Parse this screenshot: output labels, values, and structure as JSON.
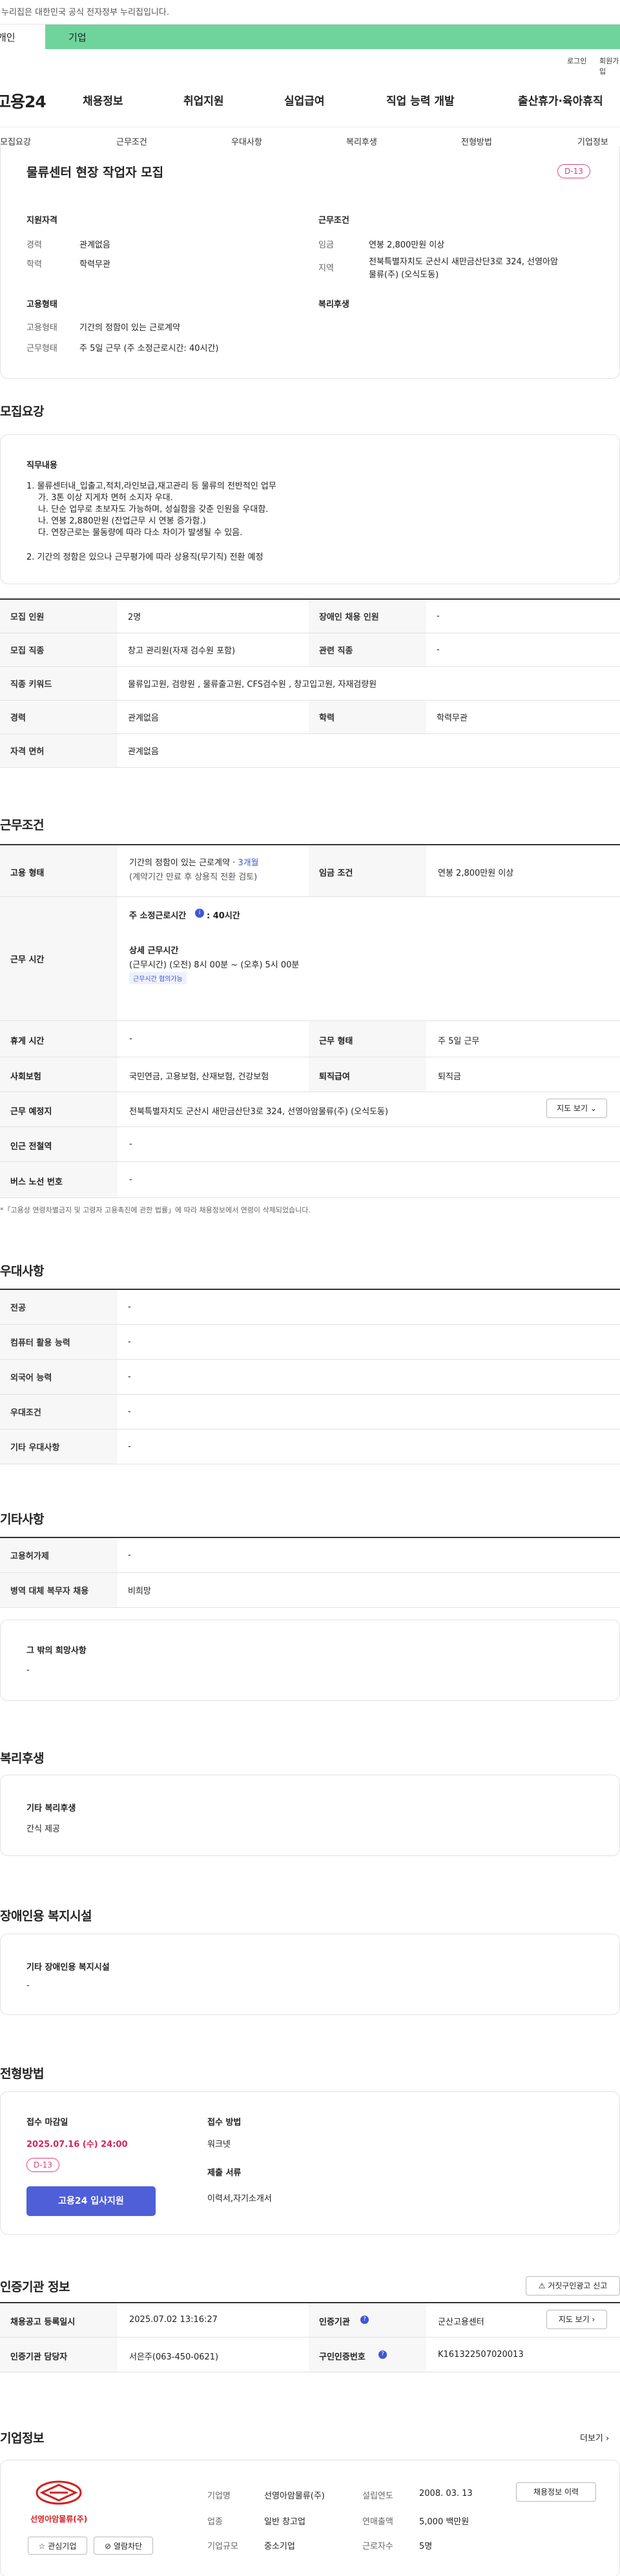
{
  "gov_banner": "이 누리집은 대한민국 공식 전자정부 누리집입니다.",
  "top_tabs": [
    "개인",
    "기업"
  ],
  "util": [
    "로그인",
    "회원가입"
  ],
  "logo": "고용24",
  "gnav": [
    "채용정보",
    "취업지원",
    "실업급여",
    "직업 능력 개발",
    "출산휴가·육아휴직"
  ],
  "subnav": [
    "모집요강",
    "근무조건",
    "우대사항",
    "복리후생",
    "전형방법",
    "기업정보"
  ],
  "summary": {
    "title": "물류센터 현장 작업자 모집",
    "dday": "D-13",
    "qual_h": "지원자격",
    "cond_h": "근무조건",
    "career_l": "경력",
    "career_v": "관계없음",
    "edu_l": "학력",
    "edu_v": "학력무관",
    "pay_l": "임금",
    "pay_v": "연봉 2,800만원 이상",
    "area_l": "지역",
    "area_v1": "전북특별자치도 군산시 새만금산단3로 324, 선영아암",
    "area_v2": "물류(주) (오식도동)",
    "emp_h": "고용형태",
    "welfare_h": "복리후생",
    "emp_l": "고용형태",
    "emp_v": "기간의 정함이 있는 근로계약",
    "hours_l": "근무형태",
    "hours_v": "주 5일 근무 (주 소정근로시간: 40시간)"
  },
  "recruit": {
    "title": "모집요강",
    "duty_h": "직무내용",
    "duty_lines": [
      "1. 물류센터내_입출고,적치,라인보급,재고관리 등 물류의 전반적인 업무",
      "가. 3톤 이상 지게차 면허 소지자 우대.",
      "나. 단순 업무로 초보자도 가능하며, 성실함을 갖춘 인원을 우대함.",
      "나. 연봉 2,880만원 (잔업근무 시 연봉 증가함.)",
      "다. 연장근로는 물동량에 따라 다소 차이가 발생될 수 있음.",
      "2. 기간의 정함은 있으나 근무평가에 따라 상용직(무기직) 전환 예정"
    ],
    "rows": [
      [
        "모집 인원",
        "2명",
        "장애인 채용 인원",
        "-"
      ],
      [
        "모집 직종",
        "창고 관리원(자재 검수원 포함)",
        "관련 직종",
        "-"
      ]
    ],
    "keywords_h": "직종 키워드",
    "keywords_v": "물류입고원, 검량원 , 물류출고원, CFS검수원 , 창고입고원, 자재검량원",
    "career_h": "경력",
    "career_v": "관계없음",
    "edu_h": "학력",
    "edu_v": "학력무관",
    "license_h": "자격 면허",
    "license_v": "관계없음"
  },
  "conditions": {
    "title": "근무조건",
    "emp_h": "고용 형태",
    "emp_v1": "기간의 정함이 있는 근로계약 ·",
    "emp_v1b": "3개월",
    "emp_v2": "(계약기간 만료 후 상용직 전환 검토)",
    "pay_h": "임금 조건",
    "pay_v": "연봉 2,800만원 이상",
    "time_h": "근무 시간",
    "time_a": "주 소정근로시간",
    "time_a2": ": 40시간",
    "time_b": "상세 근무시간",
    "time_c": "(근무시간) (오전) 8시 00분 ~ (오후) 5시 00분",
    "time_tag": "근무시간 협의가능",
    "rest_h": "휴게 시간",
    "rest_v": "-",
    "form_h": "근무 형태",
    "form_v": "주 5일 근무",
    "ins_h": "사회보험",
    "ins_v": "국민연금, 고용보험, 산재보험, 건강보험",
    "sev_h": "퇴직급여",
    "sev_v": "퇴직금",
    "place_h": "근무 예정지",
    "place_v": "전북특별자치도 군산시 새만금산단3로 324, 선영아암물류(주) (오식도동)",
    "map_btn": "지도 보기",
    "sub_h": "인근 전철역",
    "sub_v": "-",
    "bus_h": "버스 노선 번호",
    "bus_v": "-",
    "note": "*「고용상 연령차별금지 및 고령자 고용촉진에 관한 법률」에 따라 채용정보에서 연령이 삭제되었습니다."
  },
  "pref": {
    "title": "우대사항",
    "rows": [
      [
        "전공",
        "-"
      ],
      [
        "컴퓨터 활용 능력",
        "-"
      ],
      [
        "외국어 능력",
        "-"
      ],
      [
        "우대조건",
        "-"
      ],
      [
        "기타 우대사항",
        "-"
      ]
    ]
  },
  "etc": {
    "title": "기타사항",
    "rows": [
      [
        "고용허가제",
        "-"
      ],
      [
        "병역 대체 복무자 채용",
        "비희망"
      ]
    ],
    "box_h": "그 밖의 희망사항",
    "box_v": "-"
  },
  "welfare": {
    "title": "복리후생",
    "h": "기타 복리후생",
    "v": "간식 제공"
  },
  "disab": {
    "title": "장애인용 복지시설",
    "h": "기타 장애인용 복지시설",
    "v": "-"
  },
  "process": {
    "title": "전형방법",
    "deadline_h": "접수 마감일",
    "deadline_v": "2025.07.16 (수) 24:00",
    "dday": "D-13",
    "apply_btn": "고용24 입사지원",
    "method_h": "접수 방법",
    "method_v": "워크넷",
    "docs_h": "제출 서류",
    "docs_v": "이력서,자기소개서"
  },
  "cert": {
    "title": "인증기관 정보",
    "report_btn": "거짓구인광고 신고",
    "rows": [
      [
        "채용공고 등록일시",
        "2025.07.02 13:16:27",
        "인증기관",
        "군산고용센터"
      ],
      [
        "인증기관 담당자",
        "서은주(063-450-0621)",
        "구인인증번호",
        "K161322507020013"
      ]
    ],
    "history_btn": "채용정보 이력"
  },
  "company": {
    "title": "기업정보",
    "more": "더보기",
    "logo_text": "선영아암물류(주)",
    "fav_btn": "관심기업",
    "block_btn": "열람차단",
    "name_h": "기업명",
    "name_v": "선영아암물류(주)",
    "year_h": "설립연도",
    "year_v": "2008. 03. 13",
    "ind_h": "업종",
    "ind_v": "일반 창고업",
    "sales_h": "연매출액",
    "sales_v": "5,000 백만원",
    "size_h": "기업규모",
    "size_v": "중소기업",
    "emp_h": "근로자수",
    "emp_v": "5명",
    "hist_btn": "채용정보 이력"
  }
}
